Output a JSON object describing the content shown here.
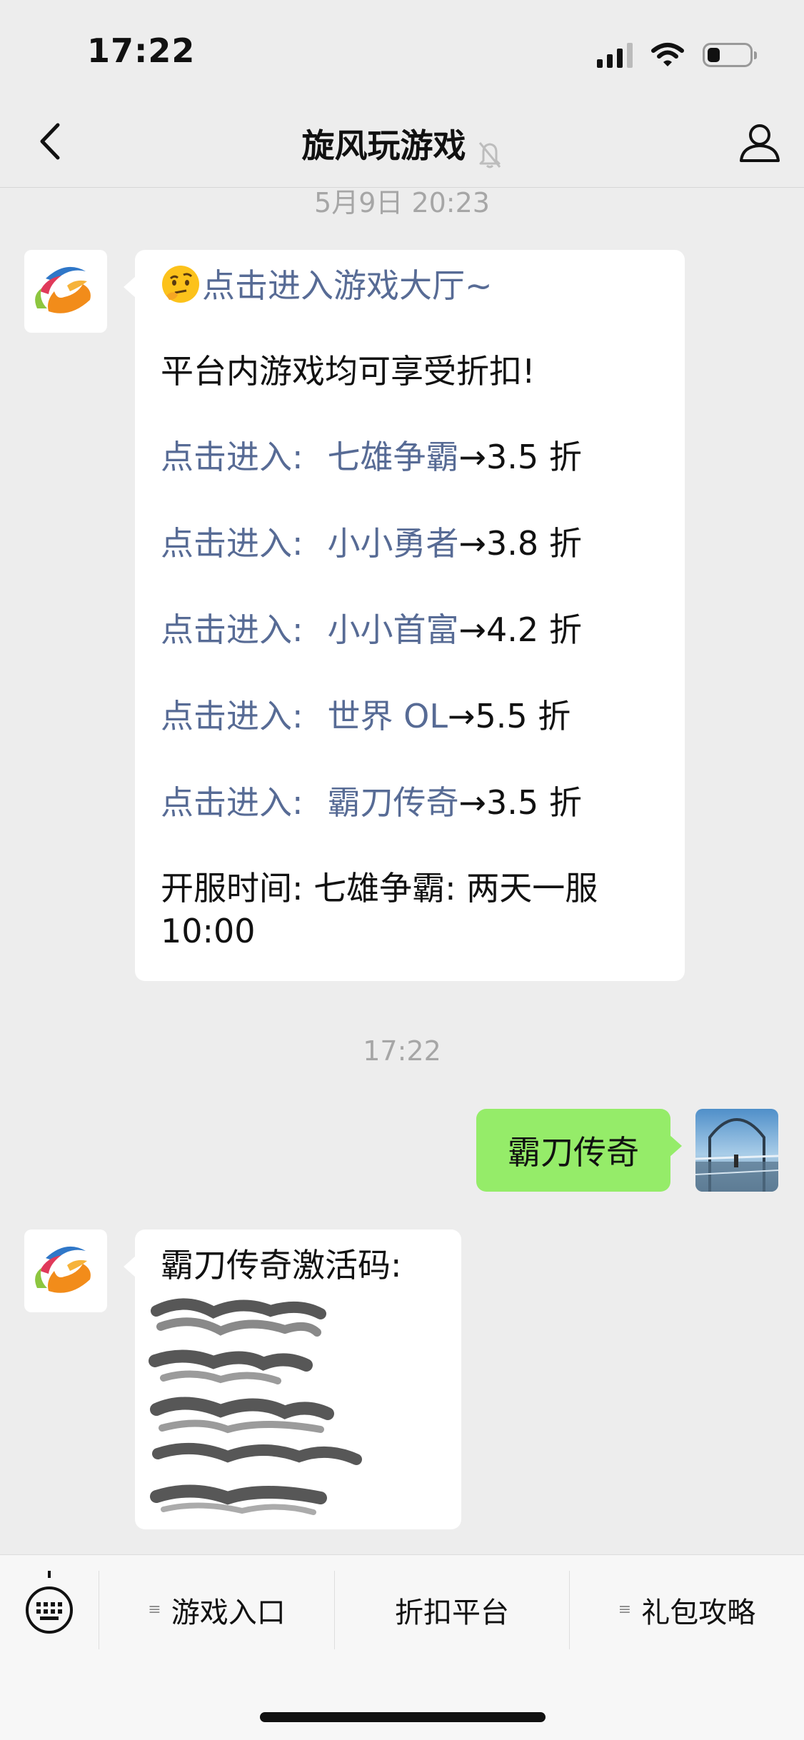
{
  "status_bar": {
    "time": "17:22",
    "battery_level": 0.3
  },
  "nav": {
    "title": "旋风玩游戏",
    "muted": true
  },
  "chat": {
    "top_timestamp": "5月9日 20:23",
    "message1": {
      "first_link": "点击进入游戏大厅~",
      "intro": "平台内游戏均可享受折扣!",
      "games": [
        {
          "prefix": "点击进入:",
          "name": "七雄争霸",
          "discount": "→3.5 折"
        },
        {
          "prefix": "点击进入:",
          "name": "小小勇者",
          "discount": "→3.8 折"
        },
        {
          "prefix": "点击进入:",
          "name": "小小首富",
          "discount": "→4.2 折"
        },
        {
          "prefix": "点击进入:",
          "name": "世界 OL",
          "discount": "→5.5 折"
        },
        {
          "prefix": "点击进入:",
          "name": "霸刀传奇",
          "discount": "→3.5 折"
        }
      ],
      "schedule_line1": "开服时间: 七雄争霸: 两天一服",
      "schedule_line2": "10:00"
    },
    "mid_timestamp": "17:22",
    "user_message": "霸刀传奇",
    "message2": {
      "title": "霸刀传奇激活码:"
    }
  },
  "menu": {
    "items": [
      {
        "label": "游戏入口",
        "has_submenu": true
      },
      {
        "label": "折扣平台",
        "has_submenu": false
      },
      {
        "label": "礼包攻略",
        "has_submenu": true
      }
    ]
  },
  "colors": {
    "link": "#576b95",
    "bubble_green": "#95ec69",
    "background": "#ededed"
  }
}
